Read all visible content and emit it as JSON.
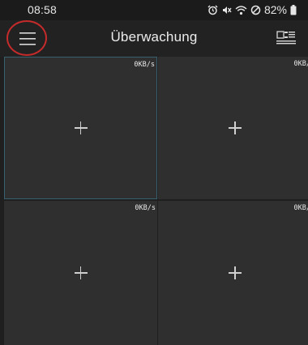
{
  "status_bar": {
    "time": "08:58",
    "battery": "82%",
    "icons": [
      "alarm-icon",
      "mute-icon",
      "wifi-icon",
      "do-not-disturb-icon",
      "battery-icon"
    ]
  },
  "header": {
    "title": "Überwachung",
    "menu_icon": "hamburger-menu-icon",
    "device_icon": "device-list-icon",
    "highlight_color": "#c62b2b"
  },
  "tiles": [
    {
      "speed": "0KB/s",
      "add_icon": "plus-icon",
      "selected": true
    },
    {
      "speed": "0KB/",
      "add_icon": "plus-icon",
      "selected": false
    },
    {
      "speed": "0KB/s",
      "add_icon": "plus-icon",
      "selected": false
    },
    {
      "speed": "0KB/",
      "add_icon": "plus-icon",
      "selected": false
    }
  ],
  "colors": {
    "background": "#1f1f1f",
    "tile": "#2f2f2f",
    "selected_border": "#38606f"
  }
}
